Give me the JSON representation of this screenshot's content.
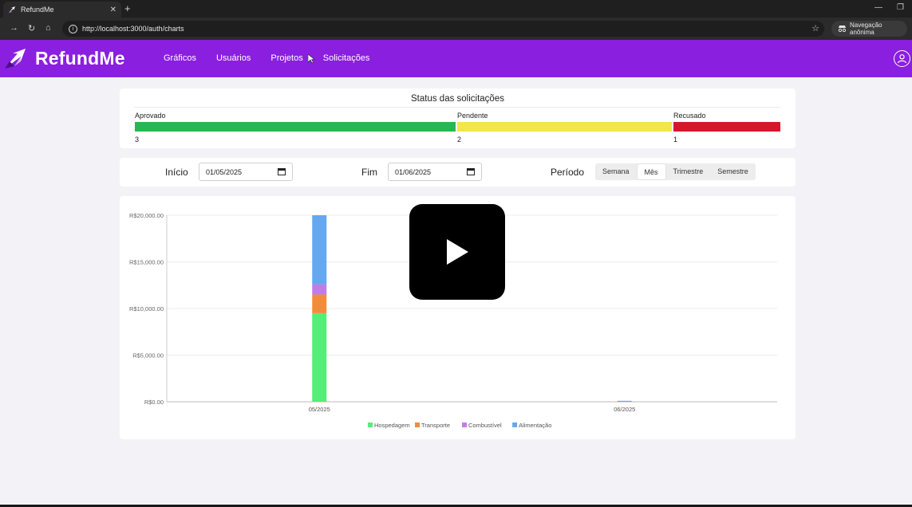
{
  "browser": {
    "tab_title": "RefundMe",
    "tab_close": "✕",
    "new_tab": "+",
    "url": "http://localhost:3000/auth/charts",
    "incognito_label": "Navegação anônima",
    "icons": [
      "back-icon",
      "reload-icon",
      "home-icon",
      "info-icon",
      "star-icon",
      "incognito-icon"
    ]
  },
  "app": {
    "logo_text": "RefundMe",
    "brand_color": "#8a1fe0",
    "nav": [
      {
        "label": "Gráficos"
      },
      {
        "label": "Usuários"
      },
      {
        "label": "Projetos"
      },
      {
        "label": "Solicitações"
      }
    ]
  },
  "status": {
    "title": "Status das solicitações",
    "segments": [
      {
        "label": "Aprovado",
        "count": "3",
        "color": "#28b84f"
      },
      {
        "label": "Pendente",
        "count": "2",
        "color": "#f2e64a"
      },
      {
        "label": "Recusado",
        "count": "1",
        "color": "#d4172a"
      }
    ]
  },
  "filters": {
    "start_label": "Início",
    "start_value": "01/05/2025",
    "end_label": "Fim",
    "end_value": "01/06/2025",
    "period_label": "Período",
    "period_options": [
      "Semana",
      "Mês",
      "Trimestre",
      "Semestre"
    ],
    "period_selected": "Mês"
  },
  "chart_data": {
    "type": "bar",
    "stacked": true,
    "categories": [
      "05/2025",
      "06/2025"
    ],
    "y_tick_labels": [
      "R$0.00",
      "R$5,000.00",
      "R$10,000.00",
      "R$15,000.00",
      "R$20,000.00"
    ],
    "ylim": [
      0,
      20000
    ],
    "grid": true,
    "legend_position": "bottom",
    "series": [
      {
        "name": "Hospedagem",
        "color": "#55ee77",
        "values": [
          9500,
          0
        ]
      },
      {
        "name": "Transporte",
        "color": "#f28c3a",
        "values": [
          2000,
          0
        ]
      },
      {
        "name": "Combustível",
        "color": "#c07de8",
        "values": [
          1100,
          0
        ]
      },
      {
        "name": "Alimentação",
        "color": "#64a8f0",
        "values": [
          7400,
          100
        ]
      }
    ]
  }
}
